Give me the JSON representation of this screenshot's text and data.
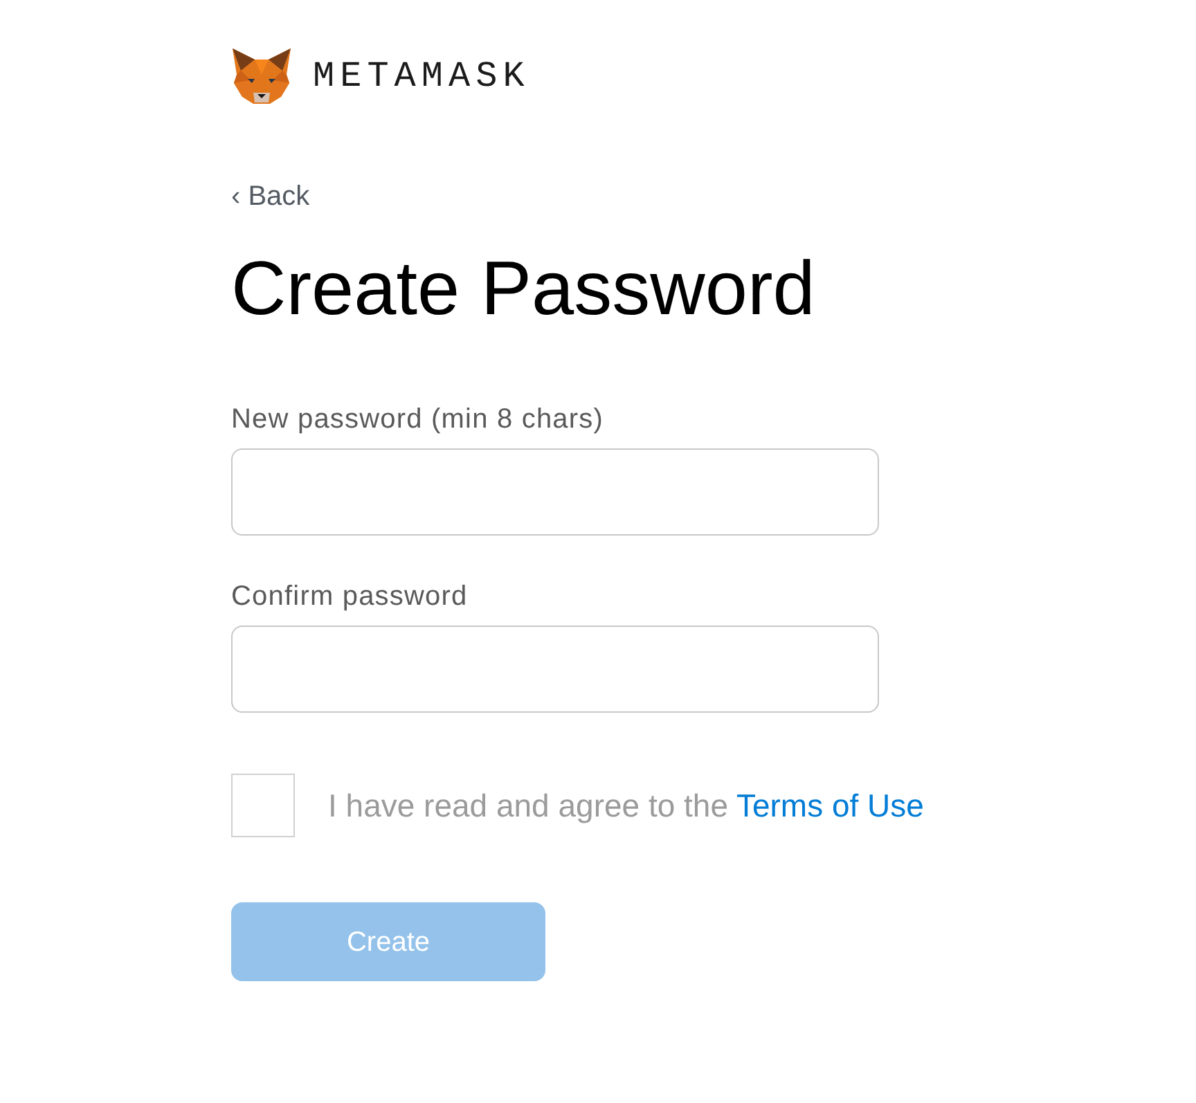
{
  "logo": {
    "wordmark": "METAMASK"
  },
  "back_link": "‹ Back",
  "title": "Create Password",
  "fields": [
    {
      "label": "New password (min 8 chars)"
    },
    {
      "label": "Confirm password"
    }
  ],
  "terms": {
    "checked": false,
    "text": "I have read and agree to the",
    "link": "Terms of Use"
  },
  "create_button": {
    "label": "Create",
    "disabled": true
  }
}
